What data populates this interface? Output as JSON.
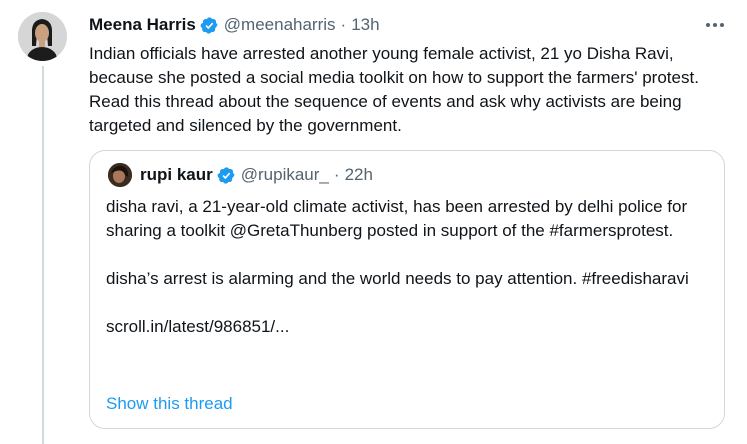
{
  "tweet": {
    "author_name": "Meena Harris",
    "author_handle": "@meenaharris",
    "separator": "·",
    "time": "13h",
    "text": "Indian officials have arrested another young female activist, 21 yo Disha Ravi, because she posted a social media toolkit on how to support the farmers' protest. Read this thread about the sequence of events and ask why activists are being targeted and silenced by the government."
  },
  "quote": {
    "author_name": "rupi kaur",
    "author_handle": "@rupikaur_",
    "separator": "·",
    "time": "22h",
    "paragraph1": "disha ravi, a 21-year-old climate activist, has been arrested by delhi police for sharing a toolkit @GretaThunberg  posted in support of the #farmersprotest.",
    "paragraph2": "disha’s arrest is alarming and the world needs to pay attention. #freedisharavi",
    "link": "scroll.in/latest/986851/...",
    "show_thread_label": "Show this thread"
  },
  "colors": {
    "accent": "#1d9bf0",
    "text": "#0f1419",
    "muted": "#536471",
    "border": "#cfd9de"
  },
  "icons": [
    "verified-badge-icon",
    "more-options-icon"
  ]
}
